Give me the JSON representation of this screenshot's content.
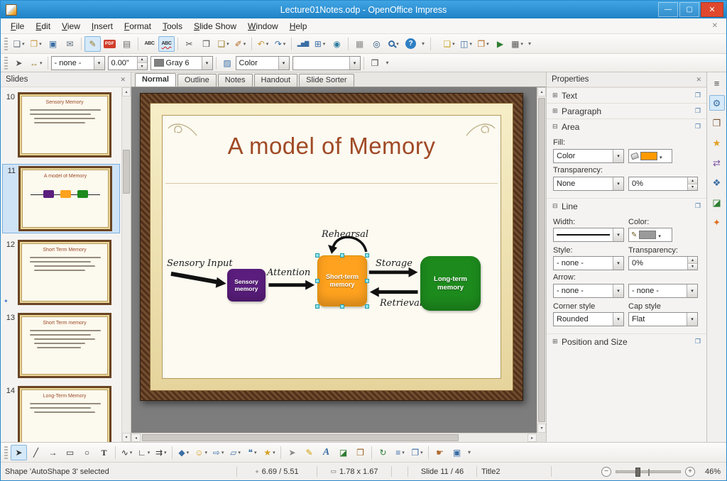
{
  "window": {
    "title": "Lecture01Notes.odp - OpenOffice Impress",
    "minimize_glyph": "—",
    "maximize_glyph": "▢",
    "close_glyph": "✕"
  },
  "menubar": {
    "items": [
      "File",
      "Edit",
      "View",
      "Insert",
      "Format",
      "Tools",
      "Slide Show",
      "Window",
      "Help"
    ],
    "close_glyph": "✕"
  },
  "toolbars": {
    "overflow_glyph": "▾",
    "main": {
      "file_group": [
        {
          "name": "new-document-icon",
          "glyph": "❏",
          "fg": "#5a6a7a",
          "cls": "drop"
        },
        {
          "name": "open-icon",
          "glyph": "❐",
          "fg": "#c7973a",
          "cls": "drop"
        },
        {
          "name": "save-icon",
          "glyph": "▣",
          "fg": "#3a6ea5",
          "cls": ""
        },
        {
          "name": "email-icon",
          "glyph": "✉",
          "fg": "#5a6a7a",
          "cls": ""
        }
      ],
      "edit_group": [
        {
          "name": "edit-file-icon",
          "glyph": "✎",
          "fg": "#9a7b2a",
          "cls": "active"
        },
        {
          "name": "export-pdf-icon",
          "glyph": "PDF",
          "fg": "#ffffff",
          "cls": "pdf"
        },
        {
          "name": "print-icon",
          "glyph": "▤",
          "fg": "#6a6a6a",
          "cls": ""
        }
      ],
      "spell_group": [
        {
          "name": "spelling-icon",
          "glyph": "ABC",
          "fg": "#333333",
          "cls": "abc"
        },
        {
          "name": "autospellcheck-icon",
          "glyph": "ABC",
          "fg": "#333333",
          "cls": "abc redline active"
        }
      ],
      "clipboard_group": [
        {
          "name": "cut-icon",
          "glyph": "✂",
          "fg": "#555555",
          "cls": ""
        },
        {
          "name": "copy-icon",
          "glyph": "❒",
          "fg": "#555555",
          "cls": ""
        },
        {
          "name": "paste-icon",
          "glyph": "❑",
          "fg": "#9a7b2a",
          "cls": "drop"
        },
        {
          "name": "clone-formatting-icon",
          "glyph": "✐",
          "fg": "#b06a20",
          "cls": "drop"
        }
      ],
      "undo_group": [
        {
          "name": "undo-icon",
          "glyph": "↶",
          "fg": "#c7973a",
          "cls": "drop"
        },
        {
          "name": "redo-icon",
          "glyph": "↷",
          "fg": "#3a6ea5",
          "cls": "drop"
        }
      ],
      "insert_group": [
        {
          "name": "insert-chart-icon",
          "glyph": "▂▅▇",
          "fg": "#3a6ea5",
          "cls": "chart"
        },
        {
          "name": "insert-table-icon",
          "glyph": "⊞",
          "fg": "#3a6ea5",
          "cls": "drop"
        },
        {
          "name": "hyperlink-icon",
          "glyph": "◉",
          "fg": "#2e7da0",
          "cls": ""
        }
      ],
      "view_group": [
        {
          "name": "grid-icon",
          "glyph": "▦",
          "fg": "#8a8a8a",
          "cls": ""
        },
        {
          "name": "navigator-icon",
          "glyph": "◎",
          "fg": "#28527a",
          "cls": ""
        },
        {
          "name": "zoom-icon",
          "glyph": "",
          "fg": "#3a6ea5",
          "cls": "mag drop"
        },
        {
          "name": "help-icon",
          "glyph": "?",
          "fg": "#ffffff",
          "cls": "help"
        }
      ],
      "presentation_group": [
        {
          "name": "new-slide-icon",
          "glyph": "❏",
          "fg": "#caa020",
          "cls": "drop"
        },
        {
          "name": "slide-layout-icon",
          "glyph": "◫",
          "fg": "#3a6ea5",
          "cls": "drop"
        },
        {
          "name": "slide-design-icon",
          "glyph": "❐",
          "fg": "#b06a20",
          "cls": "drop"
        },
        {
          "name": "slide-show-icon",
          "glyph": "▶",
          "fg": "#2e7d32",
          "cls": ""
        },
        {
          "name": "slide-sorter-icon",
          "glyph": "▦",
          "fg": "#555555",
          "cls": "drop"
        }
      ]
    },
    "line_fill": {
      "left_icons": [
        {
          "name": "edit-points-icon",
          "glyph": "➤",
          "fg": "#555555",
          "cls": ""
        },
        {
          "name": "arrowheads-icon",
          "glyph": "↔",
          "fg": "#9a7b2a",
          "cls": "drop"
        }
      ],
      "line_style_value": "- none -",
      "line_width_value": "0.00\"",
      "line_color_value": "Gray 6",
      "line_color_hex": "#808080",
      "area_icons": [
        {
          "name": "area-fill-icon",
          "glyph": "▨",
          "fg": "#3a6ea5",
          "cls": ""
        }
      ],
      "fill_type_value": "Color",
      "fill_color_value": "",
      "end_icons": [
        {
          "name": "shadow-icon",
          "glyph": "❒",
          "fg": "#444444",
          "cls": ""
        }
      ]
    }
  },
  "slides_panel": {
    "title": "Slides",
    "close_glyph": "✕",
    "transition_glyph": "✦",
    "slides": [
      {
        "number": "10",
        "title": "Sensory Memory"
      },
      {
        "number": "11",
        "title": "A model of Memory"
      },
      {
        "number": "12",
        "title": "Short Term Memory"
      },
      {
        "number": "13",
        "title": "Short Term memory"
      },
      {
        "number": "14",
        "title": "Long-Term Memory"
      }
    ]
  },
  "view_tabs": [
    {
      "label": "Normal",
      "cls": "active"
    },
    {
      "label": "Outline",
      "cls": ""
    },
    {
      "label": "Notes",
      "cls": ""
    },
    {
      "label": "Handout",
      "cls": ""
    },
    {
      "label": "Slide Sorter",
      "cls": ""
    }
  ],
  "slide": {
    "title": "A model of Memory",
    "labels": {
      "sensory_input": "Sensory Input",
      "attention": "Attention",
      "rehearsal": "Rehearsal",
      "storage": "Storage",
      "retrieval": "Retrieval"
    },
    "boxes": [
      {
        "text": "Sensory\nmemory",
        "color": "#5b1e7e"
      },
      {
        "text": "Short-term\nmemory",
        "color": "#ffa21f"
      },
      {
        "text": "Long-term\nmemory",
        "color": "#1d8a1d"
      }
    ]
  },
  "properties": {
    "title": "Properties",
    "close_glyph": "✕",
    "expander_open": "⊟",
    "expander_closed": "⊞",
    "launcher_glyph": "❐",
    "pencil_glyph": "✎",
    "sections": {
      "text": "Text",
      "paragraph": "Paragraph",
      "area": "Area",
      "line": "Line",
      "possize": "Position and Size"
    },
    "area": {
      "fill_label": "Fill:",
      "fill_type": "Color",
      "fill_color": "#ff9900",
      "transparency_label": "Transparency:",
      "transparency_type": "None",
      "transparency_value": "0%"
    },
    "line": {
      "width_label": "Width:",
      "color_label": "Color:",
      "color_hex": "#9a9a9a",
      "style_label": "Style:",
      "style_value": "- none -",
      "transparency_label": "Transparency:",
      "transparency_value": "0%",
      "arrow_label": "Arrow:",
      "arrow_start_value": "- none -",
      "arrow_end_value": "- none -",
      "corner_label": "Corner style",
      "corner_value": "Rounded",
      "cap_label": "Cap style",
      "cap_value": "Flat"
    }
  },
  "side_strip": {
    "icons": [
      {
        "name": "sidebar-menu-icon",
        "glyph": "≡",
        "fg": "#444444",
        "cls": ""
      },
      {
        "name": "properties-deck-icon",
        "glyph": "⚙",
        "fg": "#3a6ea5",
        "cls": "active"
      },
      {
        "name": "master-pages-icon",
        "glyph": "❐",
        "fg": "#7a5230",
        "cls": ""
      },
      {
        "name": "custom-animation-icon",
        "glyph": "★",
        "fg": "#e0a020",
        "cls": ""
      },
      {
        "name": "slide-transition-icon",
        "glyph": "⇄",
        "fg": "#7a4fa0",
        "cls": ""
      },
      {
        "name": "styles-icon",
        "glyph": "❖",
        "fg": "#3a6ea5",
        "cls": ""
      },
      {
        "name": "gallery-deck-icon",
        "glyph": "◪",
        "fg": "#2e7d32",
        "cls": ""
      },
      {
        "name": "navigator-deck-icon",
        "glyph": "✦",
        "fg": "#e07020",
        "cls": ""
      }
    ]
  },
  "drawbar": {
    "shape_group": [
      {
        "name": "select-icon",
        "glyph": "➤",
        "fg": "#333333",
        "cls": "active"
      },
      {
        "name": "line-icon",
        "glyph": "╱",
        "fg": "#333333",
        "cls": ""
      },
      {
        "name": "line-arrow-icon",
        "glyph": "→",
        "fg": "#333333",
        "cls": ""
      },
      {
        "name": "rectangle-icon",
        "glyph": "▭",
        "fg": "#333333",
        "cls": ""
      },
      {
        "name": "ellipse-icon",
        "glyph": "○",
        "fg": "#333333",
        "cls": ""
      },
      {
        "name": "text-icon",
        "glyph": "T",
        "fg": "#333333",
        "cls": "tt"
      }
    ],
    "curve_group": [
      {
        "name": "curve-icon",
        "glyph": "∿",
        "fg": "#333333",
        "cls": "drop"
      },
      {
        "name": "connector-icon",
        "glyph": "∟",
        "fg": "#333333",
        "cls": "drop"
      },
      {
        "name": "lines-arrows-icon",
        "glyph": "⇉",
        "fg": "#333333",
        "cls": "drop"
      }
    ],
    "shapes_group": [
      {
        "name": "basic-shapes-icon",
        "glyph": "◆",
        "fg": "#3a6ea5",
        "cls": "drop"
      },
      {
        "name": "symbol-shapes-icon",
        "glyph": "☺",
        "fg": "#d8a020",
        "cls": "drop"
      },
      {
        "name": "block-arrows-icon",
        "glyph": "⇨",
        "fg": "#3a6ea5",
        "cls": "drop"
      },
      {
        "name": "flowchart-icon",
        "glyph": "▱",
        "fg": "#3a6ea5",
        "cls": "drop"
      },
      {
        "name": "callouts-icon",
        "glyph": "❝",
        "fg": "#3a6ea5",
        "cls": "drop"
      },
      {
        "name": "stars-icon",
        "glyph": "★",
        "fg": "#d8a020",
        "cls": "drop"
      }
    ],
    "edit_group": [
      {
        "name": "points-icon",
        "glyph": "➤",
        "fg": "#888888",
        "cls": ""
      },
      {
        "name": "glue-points-icon",
        "glyph": "✎",
        "fg": "#d0a000",
        "cls": ""
      },
      {
        "name": "fontwork-icon",
        "glyph": "A",
        "fg": "#3a6ea5",
        "cls": "fontwork"
      },
      {
        "name": "from-file-icon",
        "glyph": "◪",
        "fg": "#2e7d32",
        "cls": ""
      },
      {
        "name": "gallery-icon",
        "glyph": "❒",
        "fg": "#9a6020",
        "cls": ""
      }
    ],
    "arrange_group": [
      {
        "name": "rotate-icon",
        "glyph": "↻",
        "fg": "#2e7d32",
        "cls": ""
      },
      {
        "name": "align-icon",
        "glyph": "≡",
        "fg": "#3a6ea5",
        "cls": "drop"
      },
      {
        "name": "arrange-icon",
        "glyph": "❐",
        "fg": "#3a6ea5",
        "cls": "drop"
      }
    ],
    "extras_group": [
      {
        "name": "interaction-icon",
        "glyph": "☛",
        "fg": "#b06a30",
        "cls": ""
      },
      {
        "name": "extrusion-icon",
        "glyph": "▣",
        "fg": "#3a6ea5",
        "cls": ""
      }
    ]
  },
  "statusbar": {
    "status_text": "Shape 'AutoShape 3' selected",
    "position_icon": "+",
    "position": "6.69 / 5.51",
    "size_icon": "▭",
    "size": "1.78 x 1.67",
    "slide": "Slide 11 / 46",
    "layout": "Title2",
    "zoom_out": "−",
    "zoom_in": "+",
    "zoom": "46%"
  }
}
